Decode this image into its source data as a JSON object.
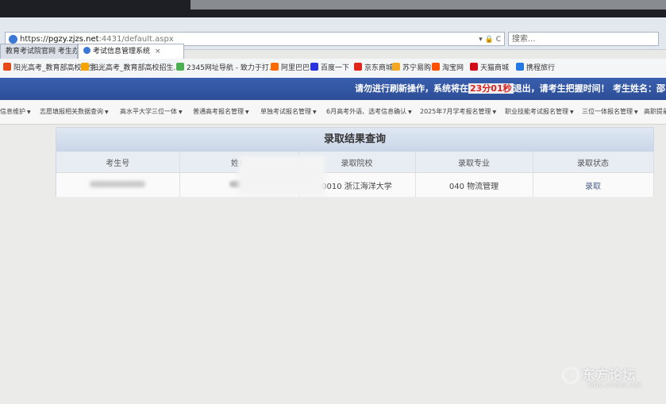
{
  "browser": {
    "url_scheme": "https://",
    "url_host": "pgzy.zjzs.net",
    "url_path": ":4431/default.aspx",
    "url_tools": "▾ 🔒 C",
    "search_placeholder": "搜索...",
    "tabs": [
      {
        "label": "教育考试院官网 考生办事"
      },
      {
        "label": "考试信息管理系统"
      }
    ],
    "tab_close": "×",
    "favorites": [
      {
        "label": "阳光高考_教育部高校招生...",
        "color": "#e64a19"
      },
      {
        "label": "阳光高考_教育部高校招生...",
        "color": "#f4a300"
      },
      {
        "label": "2345网址导航 - 致力于打...",
        "color": "#4caf50"
      },
      {
        "label": "阿里巴巴",
        "color": "#ff6a00"
      },
      {
        "label": "百度一下",
        "color": "#2932e1"
      },
      {
        "label": "京东商城",
        "color": "#e1251b"
      },
      {
        "label": "苏宁易购",
        "color": "#f5a623"
      },
      {
        "label": "淘宝网",
        "color": "#ff5000"
      },
      {
        "label": "天猫商城",
        "color": "#d20b19"
      },
      {
        "label": "携程旅行",
        "color": "#2577e3"
      }
    ]
  },
  "system_bar": {
    "notice_prefix": "请勿进行刷新操作，系统将在",
    "countdown": "23分01秒",
    "notice_suffix": "退出，请考生把握时间！",
    "candidate_label": "考生姓名：邵"
  },
  "menu": {
    "items": [
      {
        "label": "信息维护"
      },
      {
        "label": "志愿填报相关数据查询"
      },
      {
        "label": "高水平大学三位一体"
      },
      {
        "label": "普通高考报名管理"
      },
      {
        "label": "单独考试报名管理"
      },
      {
        "label": "6月高考外语、选考信息确认"
      },
      {
        "label": "2025年7月学考报名管理"
      },
      {
        "label": "职业技能考试报名管理"
      },
      {
        "label": "三位一体报名管理"
      },
      {
        "label": "高职提前"
      }
    ]
  },
  "result": {
    "title": "录取结果查询",
    "headers": [
      "考生号",
      "姓名",
      "录取院校",
      "录取专业",
      "录取状态"
    ],
    "row": {
      "school": "0010 浙江海洋大学",
      "major": "040 物流管理",
      "status": "录取"
    }
  },
  "watermark": {
    "name": "东方论坛",
    "url": "bbs.cnool.net"
  }
}
